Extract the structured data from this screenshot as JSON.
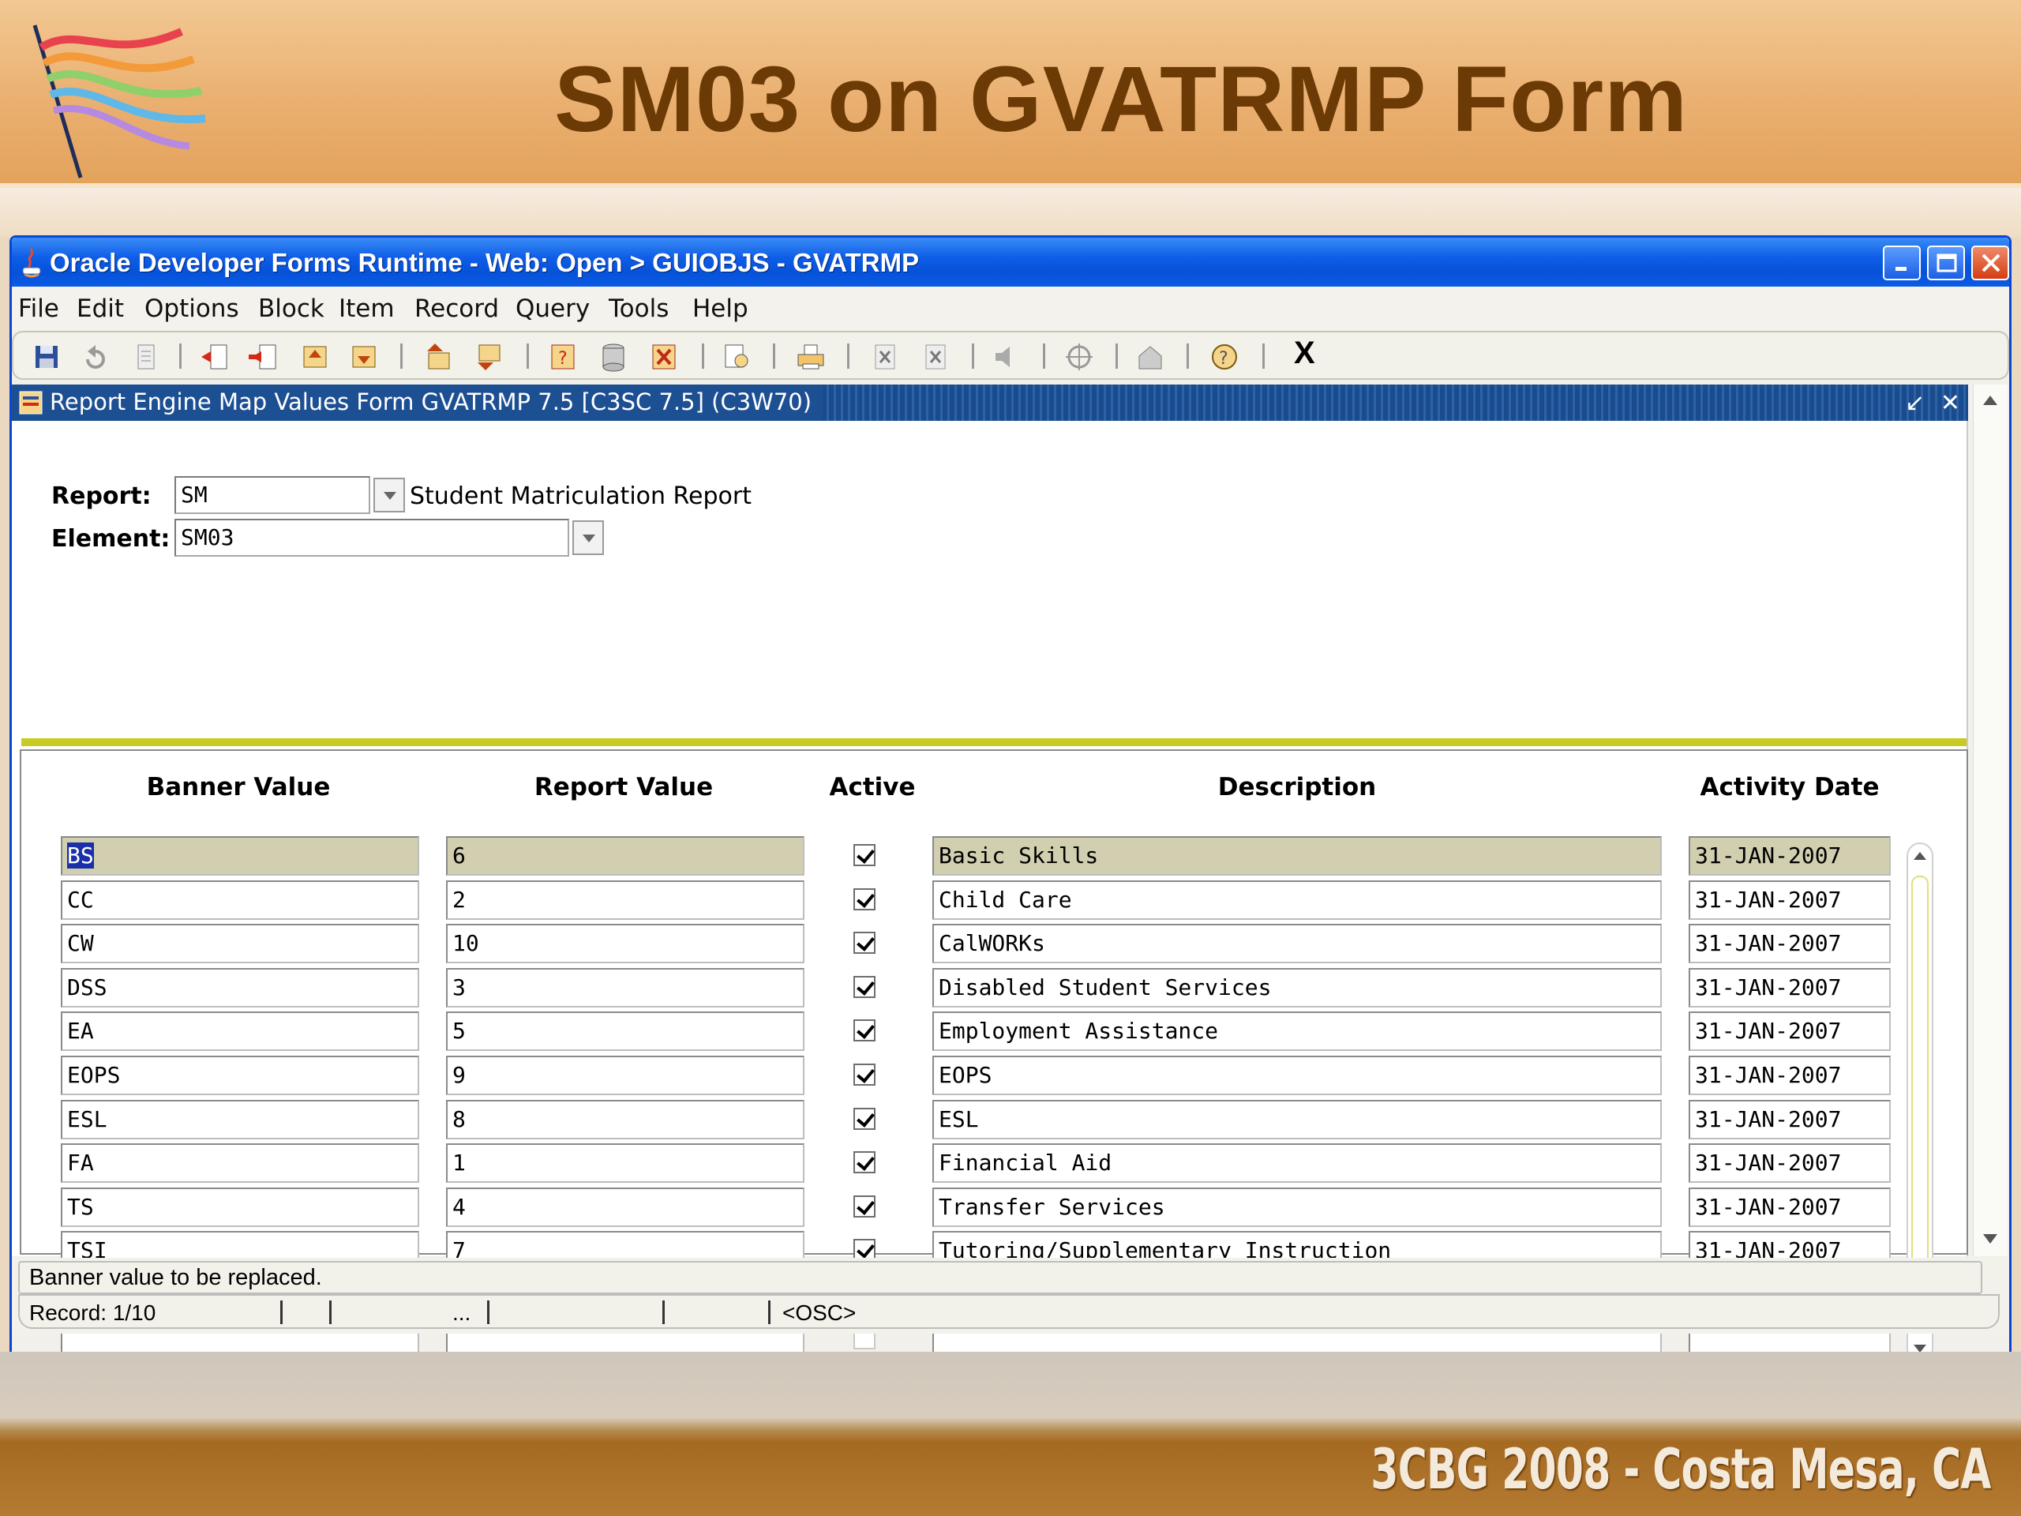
{
  "slide": {
    "title": "SM03 on GVATRMP Form",
    "footer": "3CBG 2008 - Costa Mesa, CA"
  },
  "window": {
    "title": "Oracle Developer Forms Runtime - Web:  Open > GUIOBJS - GVATRMP",
    "menu": [
      "File",
      "Edit",
      "Options",
      "Block",
      "Item",
      "Record",
      "Query",
      "Tools",
      "Help"
    ],
    "toolbar_exit": "X"
  },
  "form": {
    "title": "Report Engine Map Values Form  GVATRMP  7.5  [C3SC 7.5]  (C3W70)",
    "report_label": "Report:",
    "report_value": "SM",
    "report_desc": "Student Matriculation Report",
    "element_label": "Element:",
    "element_value": "SM03",
    "columns": [
      "Banner Value",
      "Report Value",
      "Active",
      "Description",
      "Activity Date"
    ],
    "rows": [
      {
        "banner": "BS",
        "report": "6",
        "active": true,
        "description": "Basic Skills",
        "date": "31-JAN-2007"
      },
      {
        "banner": "CC",
        "report": "2",
        "active": true,
        "description": "Child Care",
        "date": "31-JAN-2007"
      },
      {
        "banner": "CW",
        "report": "10",
        "active": true,
        "description": "CalWORKs",
        "date": "31-JAN-2007"
      },
      {
        "banner": "DSS",
        "report": "3",
        "active": true,
        "description": "Disabled Student Services",
        "date": "31-JAN-2007"
      },
      {
        "banner": "EA",
        "report": "5",
        "active": true,
        "description": "Employment Assistance",
        "date": "31-JAN-2007"
      },
      {
        "banner": "EOPS",
        "report": "9",
        "active": true,
        "description": "EOPS",
        "date": "31-JAN-2007"
      },
      {
        "banner": "ESL",
        "report": "8",
        "active": true,
        "description": "ESL",
        "date": "31-JAN-2007"
      },
      {
        "banner": "FA",
        "report": "1",
        "active": true,
        "description": "Financial Aid",
        "date": "31-JAN-2007"
      },
      {
        "banner": "TS",
        "report": "4",
        "active": true,
        "description": "Transfer Services",
        "date": "31-JAN-2007"
      },
      {
        "banner": "TSI",
        "report": "7",
        "active": true,
        "description": "Tutoring/Supplementary Instruction",
        "date": "31-JAN-2007"
      },
      {
        "banner": "",
        "report": "",
        "active": false,
        "description": "",
        "date": ""
      },
      {
        "banner": "",
        "report": "",
        "active": false,
        "description": "",
        "date": ""
      }
    ]
  },
  "status": {
    "message": "Banner value to be replaced.",
    "record": "Record: 1/10",
    "ellipsis": "...",
    "mode": "<OSC>"
  },
  "colors": {
    "title_brown": "#6b3a05",
    "titlebar_blue": "#0652d8",
    "divider_yellow": "#c7cb23",
    "current_row": "#d2ceb0"
  }
}
